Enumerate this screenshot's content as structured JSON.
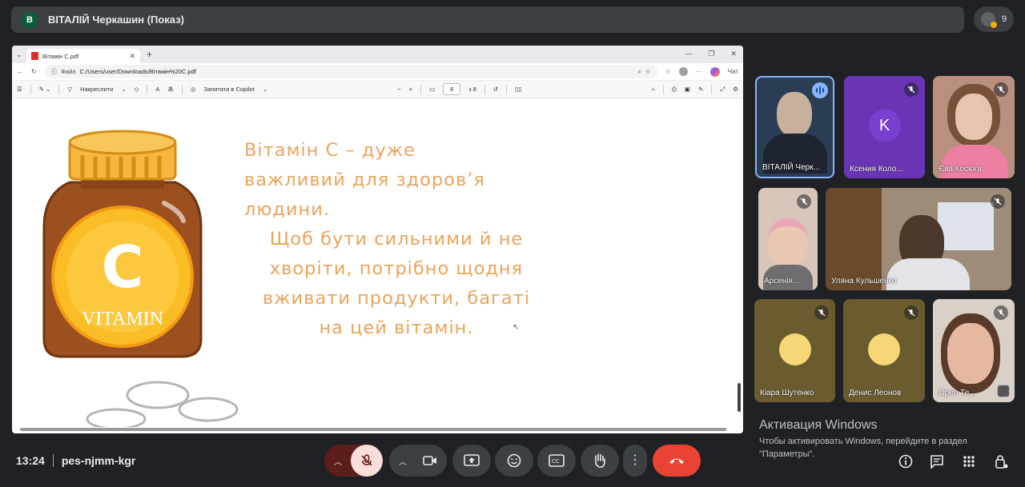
{
  "presenter_bar": {
    "avatar_letter": "В",
    "title": "ВІТАЛІЙ Черкашин (Показ)"
  },
  "people_count": "9",
  "browser": {
    "tab_title": "Вітамін C.pdf",
    "url_prefix": "Файл",
    "url": "C:/Users/user/Downloads/Вітамін%20C.pdf",
    "chat_label": "Чат",
    "toolbar": {
      "draw_label": "Накреслити",
      "copilot_label": "Запитати в Copilot",
      "page_number": "8",
      "page_total": "з 8"
    }
  },
  "slide": {
    "lines": [
      "Вітамін С – дуже",
      "важливий для здоров’я",
      "людини.",
      "Щоб бути сильними й не",
      "хворіти, потрібно щодня",
      "вживати продукти, багаті",
      "на цей вітамін."
    ],
    "bottle_letter": "C",
    "bottle_label": "VITAMIN"
  },
  "participants": [
    {
      "name": "ВІТАЛІЙ Черк...",
      "speaking": true
    },
    {
      "name": "Ксения Коло...",
      "initial": "K"
    },
    {
      "name": "Єва Косюга"
    },
    {
      "name": "Арсенія..."
    },
    {
      "name": "Уляна Кульшенко"
    },
    {
      "name": "Кіара Шутенко"
    },
    {
      "name": "Денис Леонов"
    },
    {
      "name": "Орел Те..."
    }
  ],
  "windows_activation": {
    "title": "Активация Windows",
    "text": "Чтобы активировать Windows, перейдите в раздел \"Параметры\"."
  },
  "meeting": {
    "time": "13:24",
    "code": "pes-njmm-kgr"
  },
  "colors": {
    "background": "#202124",
    "end_call": "#ea4335",
    "mic_off": "#f9dedc",
    "slide_text": "#e9a45d"
  }
}
